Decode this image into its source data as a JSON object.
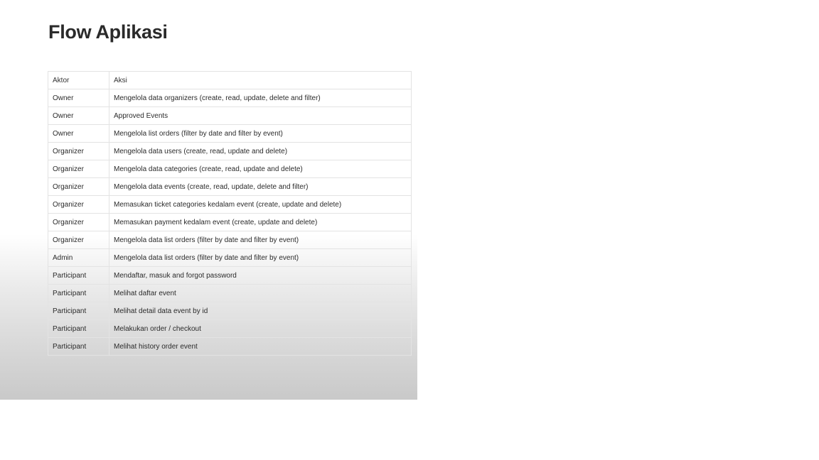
{
  "slide": {
    "title": "Flow Aplikasi"
  },
  "table": {
    "headers": {
      "actor": "Aktor",
      "action": "Aksi"
    },
    "rows": [
      {
        "actor": "Owner",
        "action": "Mengelola data organizers (create, read, update, delete and filter)"
      },
      {
        "actor": "Owner",
        "action": "Approved Events"
      },
      {
        "actor": "Owner",
        "action": "Mengelola list orders (filter by date and filter by event)"
      },
      {
        "actor": "Organizer",
        "action": "Mengelola data users (create, read, update and delete)"
      },
      {
        "actor": "Organizer",
        "action": "Mengelola data categories (create, read, update and delete)"
      },
      {
        "actor": "Organizer",
        "action": "Mengelola data events (create, read, update, delete and filter)"
      },
      {
        "actor": "Organizer",
        "action": "Memasukan ticket categories kedalam event (create, update and delete)"
      },
      {
        "actor": "Organizer",
        "action": "Memasukan payment kedalam event (create, update and delete)"
      },
      {
        "actor": "Organizer",
        "action": "Mengelola data list orders (filter by date and filter by event)"
      },
      {
        "actor": "Admin",
        "action": "Mengelola data list orders (filter by date and filter by event)"
      },
      {
        "actor": "Participant",
        "action": "Mendaftar, masuk and forgot password"
      },
      {
        "actor": "Participant",
        "action": "Melihat daftar event"
      },
      {
        "actor": "Participant",
        "action": "Melihat detail data event by id"
      },
      {
        "actor": "Participant",
        "action": "Melakukan order / checkout"
      },
      {
        "actor": "Participant",
        "action": "Melihat history order event"
      }
    ]
  }
}
